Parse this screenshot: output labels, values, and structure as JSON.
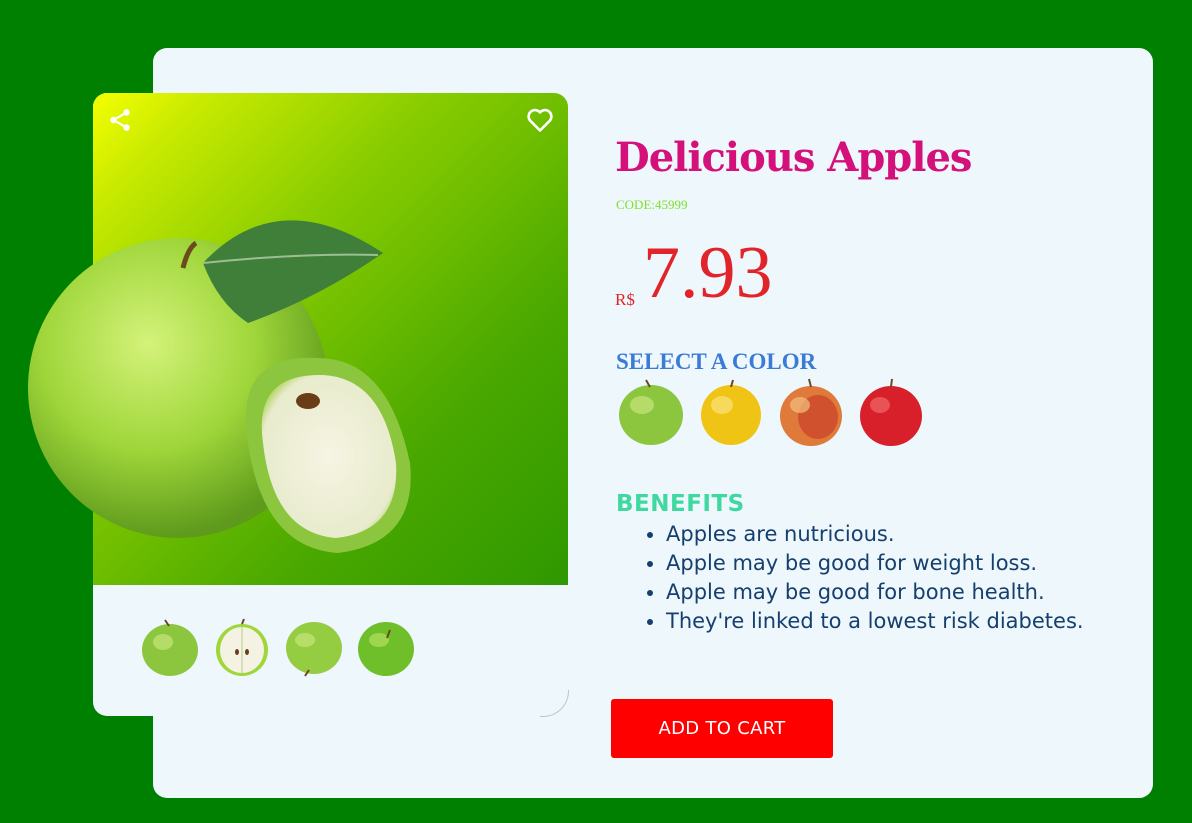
{
  "product": {
    "title": "Delicious Apples",
    "code": "CODE:45999",
    "currency": "R$",
    "price": "7.93"
  },
  "color_section": {
    "label": "SELECT A COLOR",
    "options": [
      {
        "name": "green-apple"
      },
      {
        "name": "yellow-apple"
      },
      {
        "name": "gala-apple"
      },
      {
        "name": "red-apple"
      }
    ]
  },
  "benefits": {
    "title": "BENEFITS",
    "items": [
      "Apples are nutricious.",
      "Apple may be good for weight loss.",
      "Apple may be good for bone health.",
      "They're linked to a lowest risk diabetes."
    ]
  },
  "cart": {
    "label": "ADD TO CART"
  },
  "icons": {
    "share": "share-icon",
    "favorite": "heart-icon"
  },
  "colors": {
    "background": "#008000",
    "card": "#eef7fc",
    "title": "#d4107a",
    "price": "#e0242a",
    "button": "#ff0000"
  }
}
